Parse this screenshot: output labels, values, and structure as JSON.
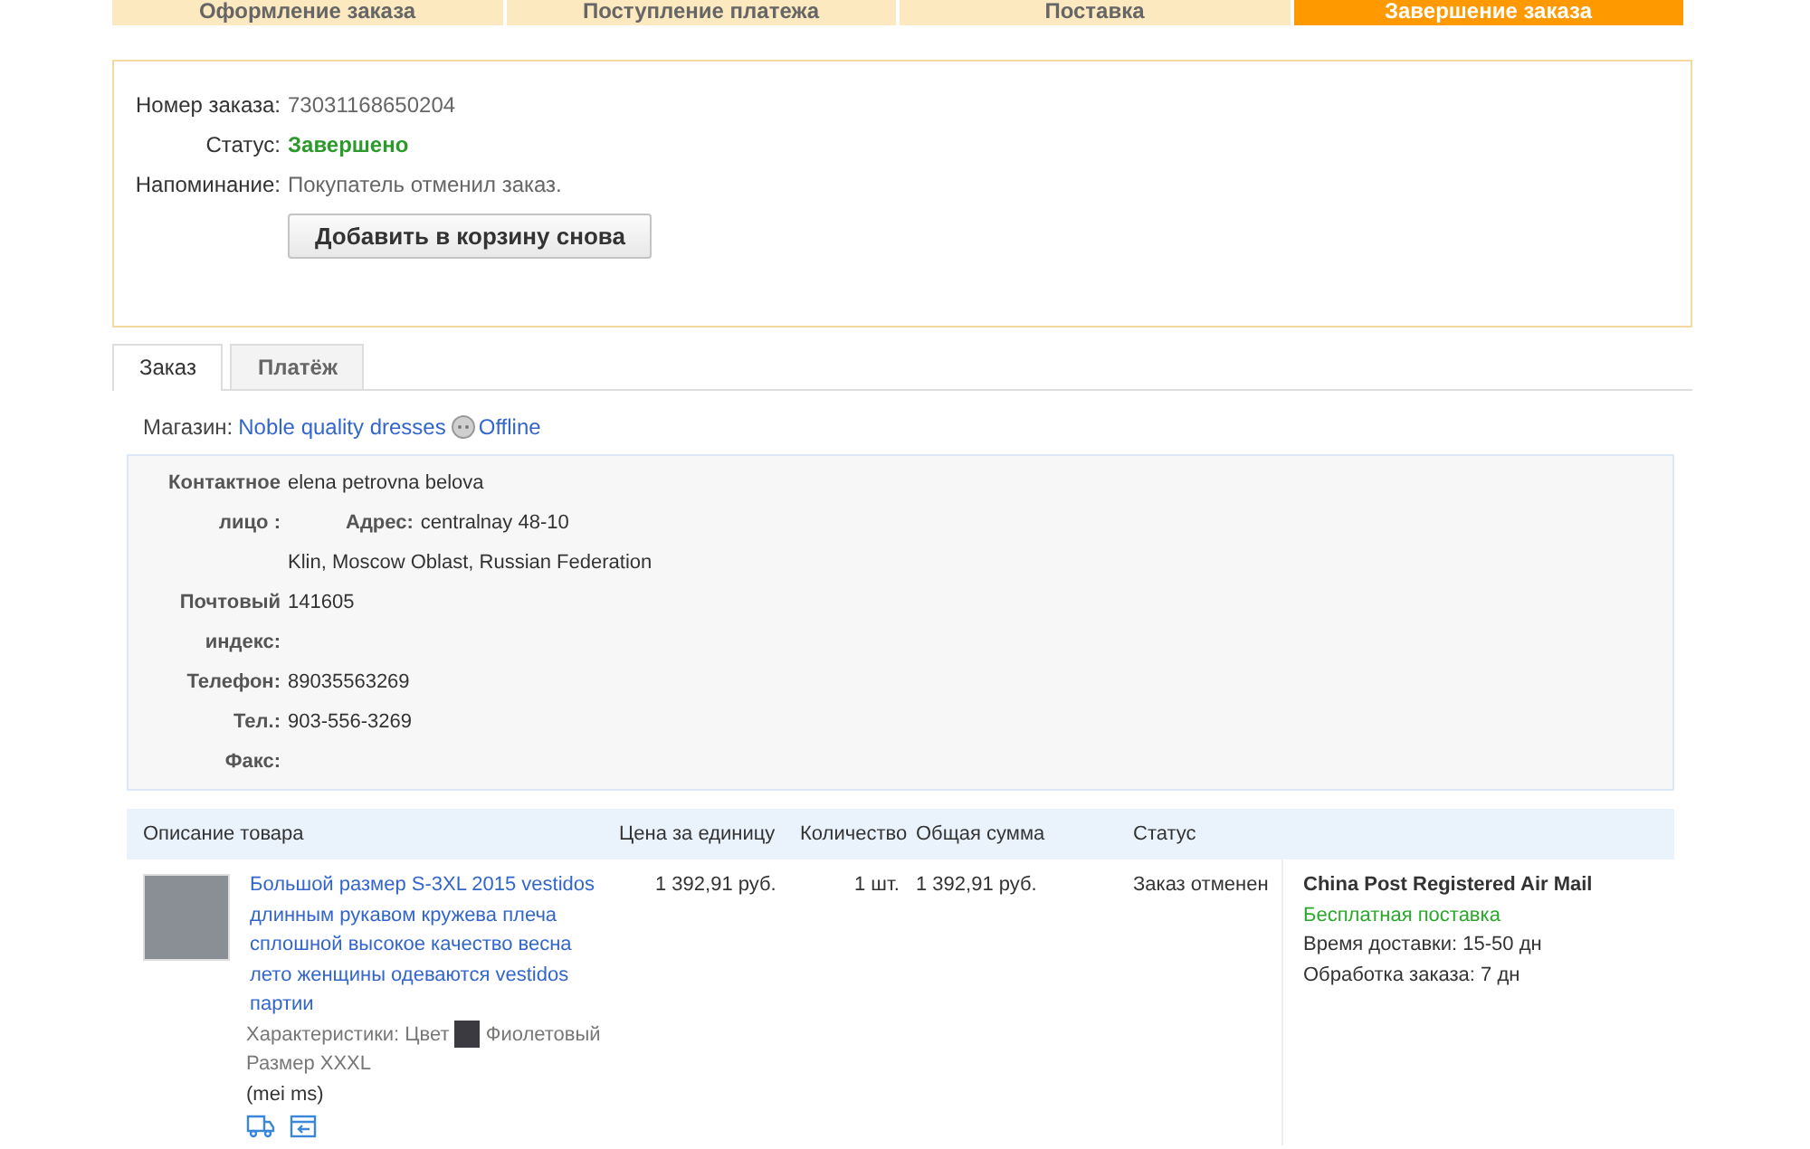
{
  "steps": [
    {
      "label": "Оформление заказа",
      "selected": false
    },
    {
      "label": "Поступление платежа",
      "selected": false
    },
    {
      "label": "Поставка",
      "selected": false
    },
    {
      "label": "Завершение заказа",
      "selected": true
    }
  ],
  "order": {
    "fields": [
      {
        "label": "Номер заказа:",
        "value": "73031168650204",
        "kind": "plain"
      },
      {
        "label": "Статус:",
        "value": "Завершено",
        "kind": "status"
      },
      {
        "label": "Напоминание:",
        "value": "Покупатель отменил заказ.",
        "kind": "plain"
      }
    ],
    "button": "Добавить в корзину снова"
  },
  "tabs": [
    {
      "label": "Заказ",
      "selected": true
    },
    {
      "label": "Платёж",
      "selected": false
    }
  ],
  "store": {
    "label": "Магазин:",
    "name": "Noble quality dresses",
    "presence": "Offline"
  },
  "contact": {
    "name_label": "Контактное лицо :",
    "name": "elena petrovna belova",
    "address_label": "Адрес:",
    "address_line1": "centralnay 48-10",
    "address_line2": "Klin, Moscow Oblast, Russian Federation",
    "zip_label": "Почтовый индекс:",
    "zip": "141605",
    "phone_label": "Телефон:",
    "phone": "89035563269",
    "tel_label": "Тел.:",
    "tel": "903-556-3269",
    "fax_label": "Факс:"
  },
  "table": {
    "columns": [
      "Описание товара",
      "Цена за единицу",
      "Количество",
      "Общая сумма",
      "Статус"
    ],
    "rows": [
      {
        "title": "Большой размер S-3XL 2015 vestidos длинным рукавом кружева плеча сплошной высокое качество весна лето женщины одеваются vestidos партии",
        "specs_label": "Характеристики: Цвет",
        "color_name": "Фиолетовый",
        "size": "Размер XXXL",
        "note": "(mei ms)",
        "price": "1 392,91 руб.",
        "quantity": "1 шт.",
        "total": "1 392,91 руб.",
        "status": "Заказ отменен",
        "shipping": {
          "method": "China Post Registered Air Mail",
          "cost": "Бесплатная поставка",
          "delivery": "Время доставки:  15-50 дн",
          "processing": "Обработка заказа:  7 дн"
        }
      }
    ]
  }
}
